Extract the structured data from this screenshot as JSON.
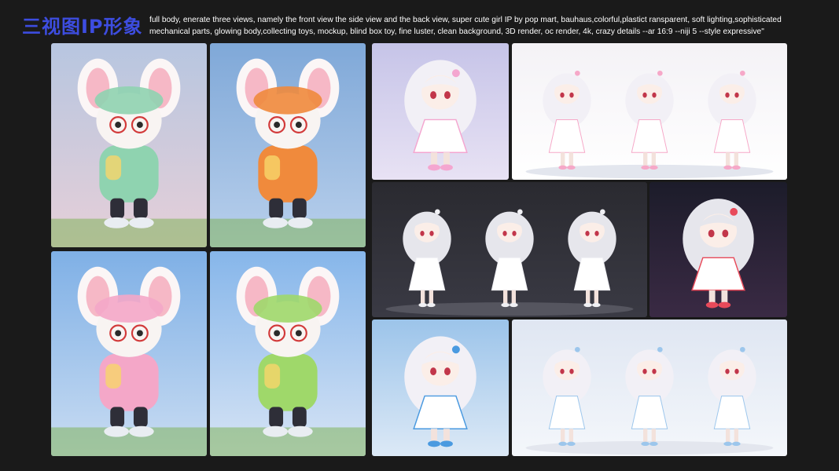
{
  "header": {
    "title": "三视图IP形象",
    "prompt": "full body, enerate three views, namely the front view the side view and the back view, super cute girl IP by pop mart, bauhaus,colorful,plastict ransparent, soft lighting,sophisticated mechanical parts, glowing body,collecting toys, mockup, blind box toy, fine luster, clean background, 3D render, oc render, 4k, crazy details --ar 16:9 --niji 5 --style expressive\""
  },
  "tiles": [
    {
      "name": "bunny-figure-glasses-front",
      "kind": "bunny",
      "bg": [
        "#b7c6e0",
        "#e6cfd8"
      ],
      "accent": "#8fd3b0"
    },
    {
      "name": "bunny-figure-scarf-side",
      "kind": "bunny",
      "bg": [
        "#7fa8d8",
        "#b9d0ec"
      ],
      "accent": "#f08a3c"
    },
    {
      "name": "bunny-figure-cap-front",
      "kind": "bunny",
      "bg": [
        "#7fb0e6",
        "#c9dcf2"
      ],
      "accent": "#f4a7c8"
    },
    {
      "name": "bunny-figure-cap-walking",
      "kind": "bunny",
      "bg": [
        "#86b6ea",
        "#d7e4f5"
      ],
      "accent": "#9fd86a"
    },
    {
      "name": "girl-figure-pink-dress",
      "kind": "girl",
      "bg": [
        "#c6c4e8",
        "#e8e2f4"
      ],
      "accent": "#f4a6d0"
    },
    {
      "name": "girl-figure-three-views-white",
      "kind": "girl3",
      "bg": [
        "#f4f2f6",
        "#ffffff"
      ],
      "accent": "#f6a8c8"
    },
    {
      "name": "girl-figure-three-views-dark",
      "kind": "girl3",
      "bg": [
        "#2a2a30",
        "#3a3a44"
      ],
      "accent": "#f0f0f4"
    },
    {
      "name": "girl-figure-stage-red",
      "kind": "girl",
      "bg": [
        "#1c1c2a",
        "#3a2a44"
      ],
      "accent": "#e84a5a"
    },
    {
      "name": "girl-figure-blue-hat",
      "kind": "girl",
      "bg": [
        "#9cc4ea",
        "#dce9f6"
      ],
      "accent": "#4a9ae0"
    },
    {
      "name": "girl-figure-three-views-blue",
      "kind": "girl3",
      "bg": [
        "#dfe6f2",
        "#f4f7fb"
      ],
      "accent": "#9cc6ec"
    }
  ]
}
